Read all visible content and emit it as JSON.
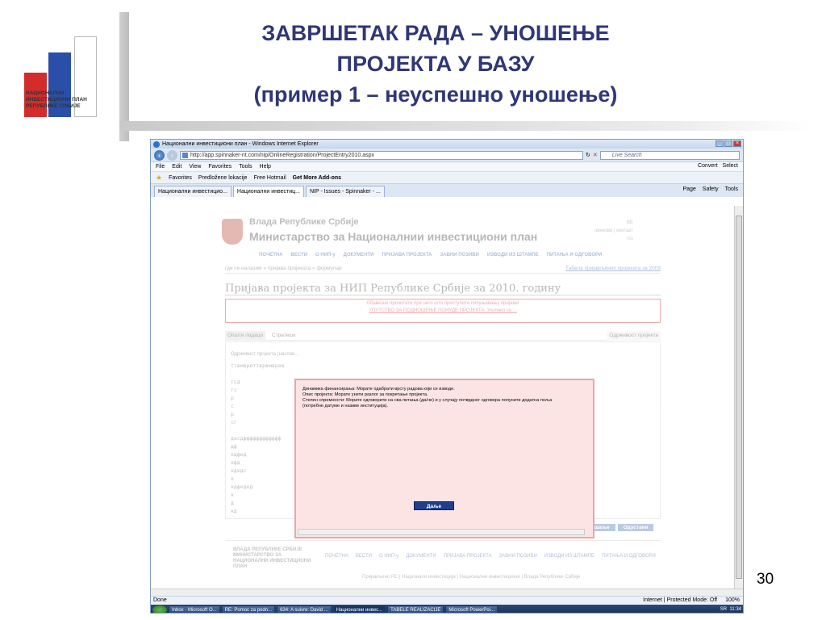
{
  "slide": {
    "title_line1": "ЗАВРШЕТАК РАДА – УНОШЕЊЕ",
    "title_line2": "ПРОЈЕКТА У БАЗУ",
    "title_line3": "(пример 1 – неуспешно уношење)",
    "logo_text": "НАЦИОНАЛНИ ИНВЕСТИЦИОНИ ПЛАН РЕПУБЛИКЕ СРБИЈЕ",
    "page_number": "30"
  },
  "browser": {
    "window_title": "Национални инвестициони план - Windows Internet Explorer",
    "url": "http://app.spinnaker-nt.com/nip/OnlineRegistration/ProjectEntry2010.aspx",
    "search_placeholder": "Live Search",
    "menu": [
      "File",
      "Edit",
      "View",
      "Favorites",
      "Tools",
      "Help"
    ],
    "menu_right": [
      "Convert",
      "Select"
    ],
    "favorites_label": "Favorites",
    "fav_items": [
      "Predložene lokacije",
      "Free Hotmail",
      "Get More Add-ons"
    ],
    "tabs": [
      "Национални инвестицио...",
      "Национални инвестиц...",
      "NIP - Issues - Spinnaker - ..."
    ],
    "tab_tools": [
      "Page",
      "Safety",
      "Tools"
    ],
    "status_left": "Done",
    "status_zone": "Internet | Protected Mode: Off",
    "zoom": "100%"
  },
  "taskbar": {
    "items": [
      "Inbox - Microsoft O...",
      "RE: Pomoc za podn...",
      "634: A suivre: David ...",
      "Национални инвес...",
      "TABELE REALIZACIJE",
      "Microsoft PowerPoi..."
    ],
    "lang": "SR",
    "time": "11:34"
  },
  "site": {
    "gov_name": "Влада Републике Србије",
    "ministry": "Министарство за Националнии инвестициони план",
    "toplinks": "ВЕ\nлинкови | контакт\nrss",
    "nav": [
      "ПОЧЕТНА",
      "ВЕСТИ",
      "О НИП-у",
      "ДОКУМЕНТИ",
      "ПРИЈАВА ПРОЈЕКТА",
      "ЗАВНИ ПОЗИВИ",
      "ИЗВОДИ ИЗ ШТАМПЕ",
      "ПИТАЊА И ОДГОВОРИ"
    ],
    "breadcrumb": "где се налазим » пријава пројеката » формулар",
    "breadcrumb_right": "Табела пријављених пројеката за 2009",
    "page_title": "Пријава пројекта за НИП Републике Србије за 2010. годину",
    "warning_line1": "Обавезно прочитати пре него што приступите попуњавању пријаве!",
    "warning_line2": "УПУТСТВО ЗА ПОДНОШЕЊЕ ПОНУДЕ ПРОЈЕКТА. Уколико се ...",
    "form_tab1": "Општи подаци",
    "form_tab2": "Стратешк",
    "form_tab_last": "Одрживост пројекта",
    "form_label": "Одрживост пројекта (наслов...",
    "form_lines": [
      "ттвмвреттврвмврвв",
      "",
      "гсд",
      "гс",
      "р",
      "с",
      "р",
      "сг",
      "",
      "дасдфффффффффффф",
      "дф",
      "кдфкд",
      "кфд",
      "кдкдс",
      "к",
      "кдфкдкд",
      "к",
      "д",
      "кд"
    ],
    "btn_prev": "Повшаље",
    "btn_cancel": "Одустани",
    "footer_left": "ВЛАДА РЕПУБЛИКЕ СРБИЈЕ МИНИСТАРСТВО ЗА НАЦИОНАЛНИ ИНВЕСТИЦИОНИ ПЛАН",
    "footer_copy": "Пријављено РС | Националн инвестиција | Национални инвестициони | Влада Републике Србије"
  },
  "modal": {
    "line1": "Динамика финансирања: Морате одабрати врсту радова који се изводе.",
    "line2": "Опис пројекта: Морате унети разлог за покретање пројекта.",
    "line3": "Степен спремности: Морате одговорити на сва питања (да/не) и у случају потврдног одговора попунити додатна поља (потребне датуме и називе институција).",
    "ok_label": "Даље"
  },
  "colors": {
    "title": "#2f3776",
    "modal_bg": "#fde4e4",
    "modal_button": "#1f3f8c"
  }
}
